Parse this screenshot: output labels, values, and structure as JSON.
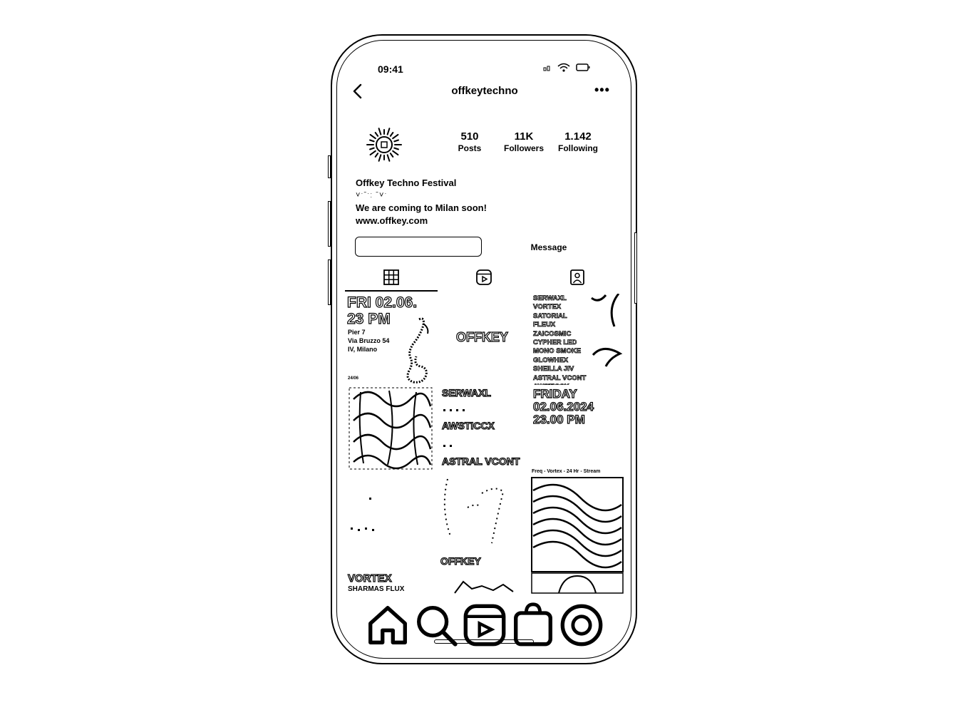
{
  "status_bar": {
    "time": "09:41"
  },
  "nav": {
    "title": "offkeytechno",
    "more": "•••"
  },
  "profile": {
    "stats": [
      {
        "value": "510",
        "label": "Posts"
      },
      {
        "value": "11K",
        "label": "Followers"
      },
      {
        "value": "1.142",
        "label": "Following"
      }
    ],
    "bio": {
      "name": "Offkey Techno Festival",
      "glyph_line": "˅ˑˉˑː ˉ˅ˑ",
      "line": "We are coming to Milan soon!",
      "link": "www.offkey.com"
    },
    "follow_label": "",
    "message_label": "Message"
  },
  "tabs": [
    "grid-icon",
    "reels-icon",
    "tagged-icon"
  ],
  "posts": {
    "p1": {
      "day": "FRI 02.06.",
      "time": "23 PM",
      "addr1": "Pier 7",
      "addr2": "Via Bruzzo 54",
      "addr3": "IV, Milano"
    },
    "p2": {
      "logo": "OFFKEY"
    },
    "p3": {
      "lineup": [
        "SERWAXL",
        "VORTEX",
        "SATORIAL FLEUX",
        "ZAICOSMIC",
        "CYPHER LED",
        "MONO SMOKE",
        "GLOWHEX",
        "SHEILLA JIV",
        "ASTRAL VCONT",
        "AWSTICCK"
      ]
    },
    "p4": {
      "tag": "24/06"
    },
    "p5": {
      "lines": [
        "SERWAXL",
        "AWSTICCX",
        "ASTRAL VCONT"
      ]
    },
    "p6": {
      "day": "FRIDAY",
      "date": "02.06.2024",
      "time": "23.00 PM"
    },
    "p8": {
      "logo": "OFFKEY"
    },
    "p9": {
      "caption": "Freq - Vortex - 24 Hr - Stream"
    },
    "p7": {
      "line1": "VORTEX",
      "line2": "SHARMAS FLUX"
    }
  },
  "bottom_nav": [
    "home-icon",
    "search-icon",
    "reels-icon",
    "shop-icon",
    "profile-icon"
  ]
}
